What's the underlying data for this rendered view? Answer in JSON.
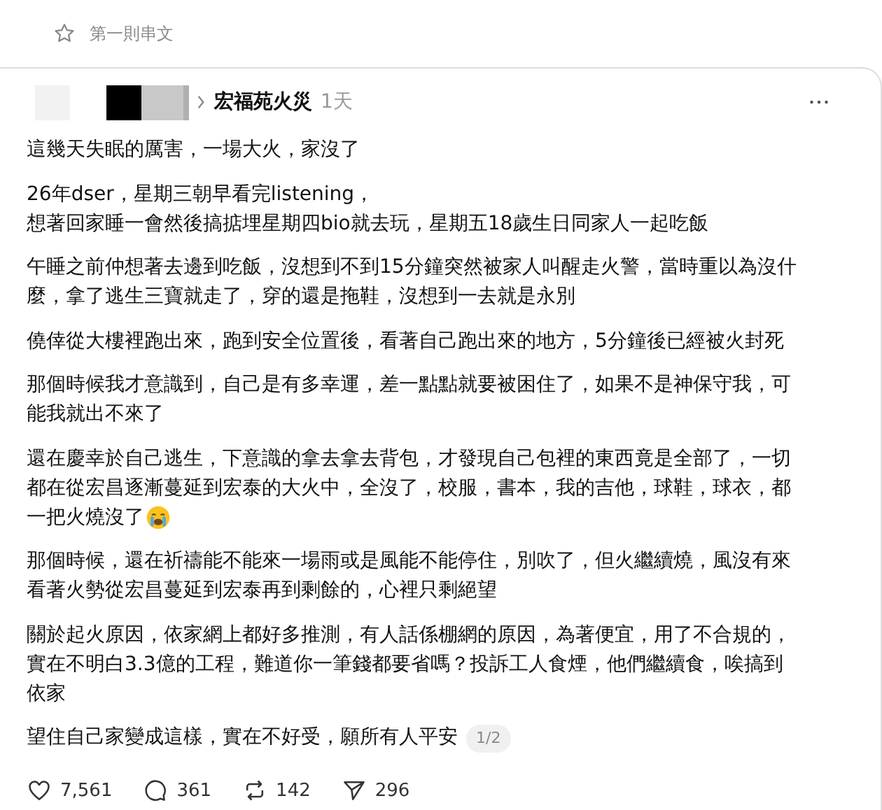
{
  "header": {
    "title": "第一則串文"
  },
  "post": {
    "topic": "宏福苑火災",
    "time": "1天",
    "paragraphs": [
      {
        "kind": "text",
        "lines": [
          "這幾天失眠的厲害，一場大火，家沒了"
        ]
      },
      {
        "kind": "text",
        "lines": [
          "26年dser，星期三朝早看完listening，",
          "想著回家睡一會然後搞掂埋星期四bio就去玩，星期五18歲生日同家人一起吃飯"
        ]
      },
      {
        "kind": "text",
        "lines": [
          "午睡之前仲想著去邊到吃飯，沒想到不到15分鐘突然被家人叫醒走火警，當時重以為沒什",
          "麼，拿了逃生三寶就走了，穿的還是拖鞋，沒想到一去就是永別"
        ]
      },
      {
        "kind": "text",
        "lines": [
          "僥倖從大樓裡跑出來，跑到安全位置後，看著自己跑出來的地方，5分鐘後已經被火封死"
        ]
      },
      {
        "kind": "text",
        "lines": [
          "那個時候我才意識到，自己是有多幸運，差一點點就要被困住了，如果不是神保守我，可",
          "能我就出不來了"
        ]
      },
      {
        "kind": "with_crying_emoji",
        "lines": [
          "還在慶幸於自己逃生，下意識的拿去拿去背包，才發現自己包裡的東西竟是全部了，一切",
          "都在從宏昌逐漸蔓延到宏泰的大火中，全沒了，校服，書本，我的吉他，球鞋，球衣，都",
          "一把火燒沒了"
        ]
      },
      {
        "kind": "text",
        "lines": [
          "那個時候，還在祈禱能不能來一場雨或是風能不能停住，別吹了，但火繼續燒，風沒有來",
          "看著火勢從宏昌蔓延到宏泰再到剩餘的，心裡只剩絕望"
        ]
      },
      {
        "kind": "text",
        "lines": [
          "關於起火原因，依家網上都好多推測，有人話係棚網的原因，為著便宜，用了不合規的，",
          "實在不明白3.3億的工程，難道你一筆錢都要省嗎？投訴工人食煙，他們繼續食，唉搞到",
          "依家"
        ]
      },
      {
        "kind": "text",
        "lines": [
          "望住自己家變成這樣，實在不好受，願所有人平安"
        ],
        "page": "1/2"
      }
    ]
  },
  "actions": [
    {
      "kind": "like",
      "count": "7,561"
    },
    {
      "kind": "reply",
      "count": "361"
    },
    {
      "kind": "repost",
      "count": "142"
    },
    {
      "kind": "share",
      "count": "296"
    }
  ]
}
